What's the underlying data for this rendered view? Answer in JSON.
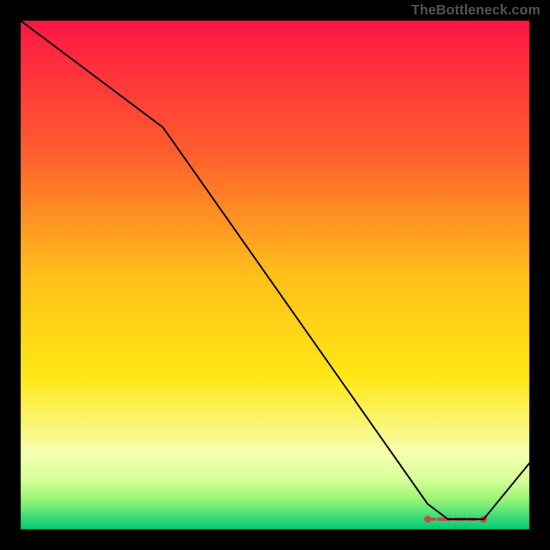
{
  "watermark": "TheBottleneck.com",
  "chart_data": {
    "type": "line",
    "title": "",
    "xlabel": "",
    "ylabel": "",
    "xlim": [
      0,
      100
    ],
    "ylim": [
      0,
      100
    ],
    "x": [
      0,
      28,
      80,
      84,
      91,
      100
    ],
    "values": [
      100,
      79,
      5,
      2,
      2,
      13
    ],
    "gradient_stops": [
      {
        "offset": 0.0,
        "color": "#ff1645"
      },
      {
        "offset": 0.25,
        "color": "#ff5a2e"
      },
      {
        "offset": 0.5,
        "color": "#ffbf1a"
      },
      {
        "offset": 0.7,
        "color": "#ffe715"
      },
      {
        "offset": 0.85,
        "color": "#f6ffb0"
      },
      {
        "offset": 0.9,
        "color": "#d9ff9a"
      },
      {
        "offset": 0.94,
        "color": "#9cf576"
      },
      {
        "offset": 0.97,
        "color": "#4de07a"
      },
      {
        "offset": 1.0,
        "color": "#00c971"
      }
    ],
    "marker_band": {
      "x_start": 80,
      "x_end": 91,
      "y": 2,
      "color": "#c24a4a"
    }
  }
}
